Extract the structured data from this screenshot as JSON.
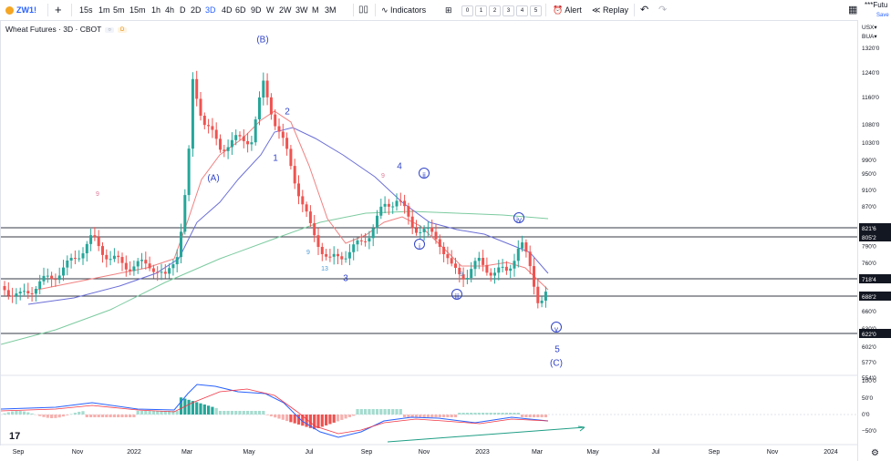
{
  "toolbar": {
    "symbol": "ZW1!",
    "add_symbol": "+",
    "intervals": [
      "15s",
      "1m",
      "5m",
      "15m",
      "1h",
      "4h",
      "D",
      "2D",
      "3D",
      "4D",
      "6D",
      "9D",
      "W",
      "2W",
      "3W",
      "M",
      "3M"
    ],
    "active_interval": "3D",
    "indicators_label": "Indicators",
    "layout_slots": [
      "0",
      "1",
      "2",
      "3",
      "4",
      "5"
    ],
    "alert_label": "Alert",
    "replay_label": "Replay",
    "layout_name": "***Futu",
    "save_label": "Save"
  },
  "legend": {
    "title": "Wheat Futures · 3D · CBOT",
    "badge1": "○",
    "badge2": "D"
  },
  "axis": {
    "currency": "USX▾",
    "unit": "BUA▾",
    "price_ticks": [
      "1320'0",
      "1240'0",
      "1160'0",
      "1080'0",
      "1030'0",
      "990'0",
      "950'0",
      "910'0",
      "870'0",
      "790'0",
      "760'0",
      "660'0",
      "630'0",
      "602'0",
      "577'0",
      "554'0"
    ],
    "indicator_ticks": [
      "100'0",
      "50'0",
      "0'0",
      "−50'0"
    ],
    "time_ticks": [
      "Sep",
      "Nov",
      "2022",
      "Mar",
      "May",
      "Jul",
      "Sep",
      "Nov",
      "2023",
      "Mar",
      "May",
      "Jul",
      "Sep",
      "Nov",
      "2024"
    ],
    "level_labels": [
      "821'6",
      "805'2",
      "718'4",
      "688'2",
      "622'0"
    ]
  },
  "waves": {
    "labels": [
      "(B)",
      "(A)",
      "2",
      "1",
      "4",
      "ii",
      "i",
      "iii",
      "iv",
      "v",
      "5",
      "(C)",
      "3"
    ],
    "counts": [
      "9",
      "9",
      "13",
      "9",
      "9"
    ]
  },
  "colors": {
    "up": "#26a69a",
    "down": "#ef5350",
    "wave": "#3144c8",
    "ma_fast": "#f08080",
    "ma_mid": "#6b6fd6",
    "ma_slow": "#7ccba0"
  },
  "chart_data": {
    "type": "candlestick",
    "symbol": "Wheat Futures · 3D · CBOT",
    "y_range": [
      554,
      1340
    ],
    "horizontal_levels": [
      821.6,
      805.2,
      718.4,
      688.2,
      622.0
    ],
    "close_path_approx": [
      {
        "x": "Sep 2021",
        "y": 715
      },
      {
        "x": "Oct 2021",
        "y": 740
      },
      {
        "x": "Nov 2021",
        "y": 800
      },
      {
        "x": "Dec 2021",
        "y": 770
      },
      {
        "x": "Jan 2022",
        "y": 760
      },
      {
        "x": "Feb 2022",
        "y": 820
      },
      {
        "x": "Mar 2022",
        "y": 1230
      },
      {
        "x": "Apr 2022",
        "y": 1040
      },
      {
        "x": "May 2022",
        "y": 1220
      },
      {
        "x": "Jun 2022",
        "y": 1020
      },
      {
        "x": "Jul 2022",
        "y": 790
      },
      {
        "x": "Aug 2022",
        "y": 780
      },
      {
        "x": "Sep 2022",
        "y": 880
      },
      {
        "x": "Oct 2022",
        "y": 880
      },
      {
        "x": "Nov 2022",
        "y": 790
      },
      {
        "x": "Dec 2022",
        "y": 740
      },
      {
        "x": "Jan 2023",
        "y": 750
      },
      {
        "x": "Feb 2023",
        "y": 780
      },
      {
        "x": "Mar 2023",
        "y": 700
      }
    ],
    "indicator": {
      "type": "macd",
      "y_range": [
        -60,
        100
      ]
    }
  }
}
